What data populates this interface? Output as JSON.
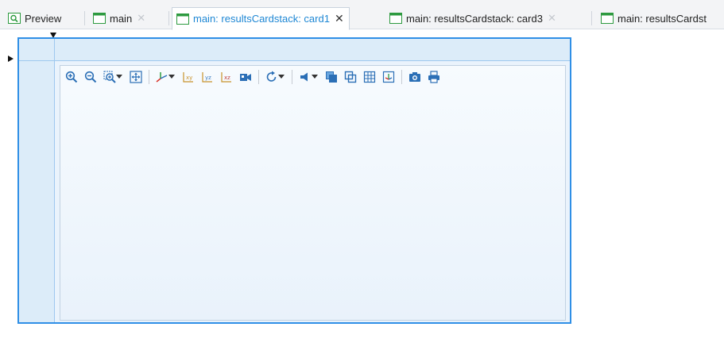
{
  "tabs": [
    {
      "label": "Preview",
      "closable": false,
      "active": false,
      "icon": "preview-icon"
    },
    {
      "label": "main",
      "closable": true,
      "active": false,
      "icon": "window-icon"
    },
    {
      "label": "main: resultsCardstack: card1",
      "closable": true,
      "active": true,
      "icon": "window-icon"
    },
    {
      "label": "main: resultsCardstack: card3",
      "closable": true,
      "active": false,
      "icon": "window-icon"
    },
    {
      "label": "main: resultsCardst",
      "closable": false,
      "active": false,
      "icon": "window-icon"
    }
  ],
  "close_glyph": "✕",
  "toolbar_icons": [
    "zoom-in-icon",
    "zoom-out-icon",
    "zoom-box-icon",
    "zoom-extents-icon",
    "axis-orientation-icon",
    "xy-plane-icon",
    "yz-plane-icon",
    "xz-plane-icon",
    "camera-movie-icon",
    "rotate-icon",
    "scene-light-icon",
    "transparency-icon",
    "wireframe-icon",
    "grid-icon",
    "axis-triad-icon",
    "image-snapshot-icon",
    "print-icon"
  ],
  "colors": {
    "accent": "#1e87d4",
    "card_border": "#2f8fe6",
    "card_fill": "#dcecf9",
    "icon_blue": "#2b6fb6"
  }
}
